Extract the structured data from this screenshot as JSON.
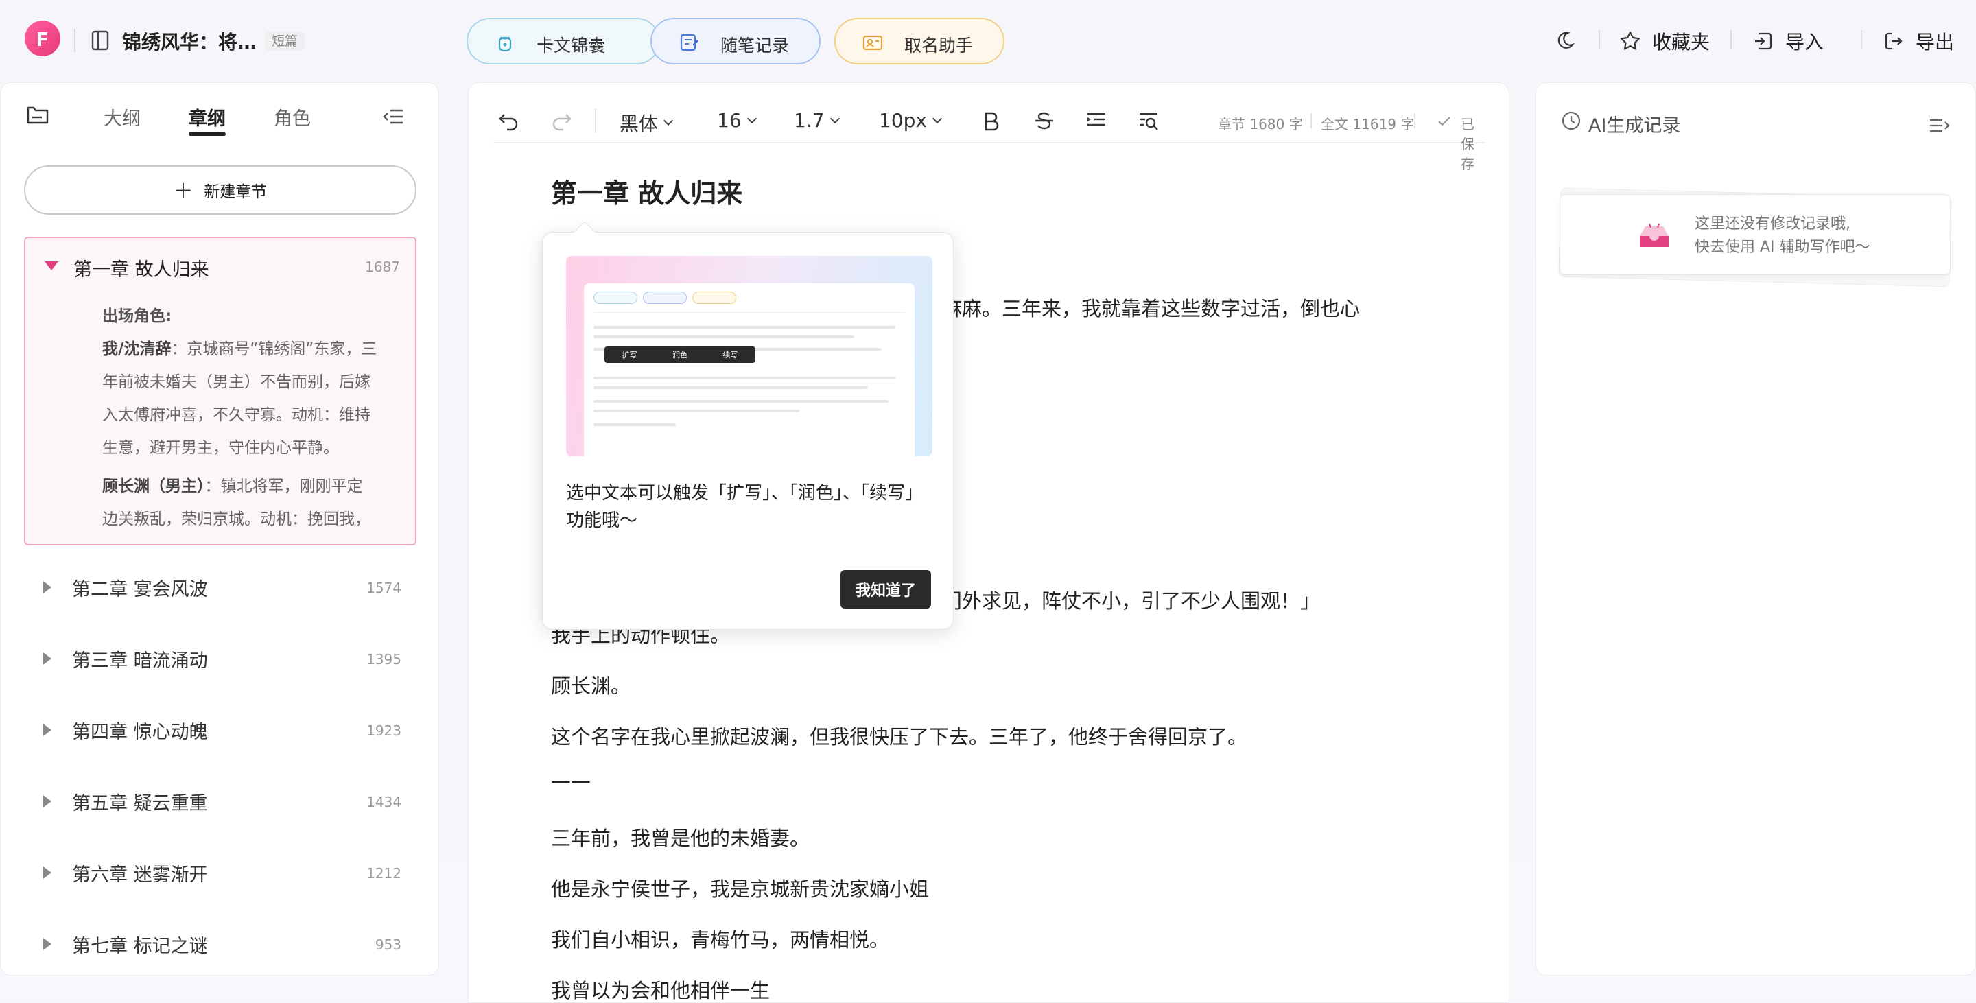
{
  "header": {
    "doc_title": "锦绣风华：将…",
    "doc_tag": "短篇",
    "pills": [
      "卡文锦囊",
      "随笔记录",
      "取名助手"
    ],
    "collect_label": "收藏夹",
    "import_label": "导入",
    "export_label": "导出"
  },
  "sidebar": {
    "tabs": [
      "大纲",
      "章纲",
      "角色"
    ],
    "active_tab": "章纲",
    "new_chapter_label": "新建章节",
    "expanded": {
      "title": "第一章 故人归来",
      "count": "1687",
      "roles_label": "出场角色:",
      "role1_name": "我/沈清辞",
      "role1_desc_l1": "：京城商号“锦绣阁”东家，三",
      "role1_desc_l2": "年前被未婚夫（男主）不告而别，后嫁",
      "role1_desc_l3": "入太傅府冲喜，不久守寡。动机：维持",
      "role1_desc_l4": "生意，避开男主，守住内心平静。",
      "role2_name": "顾长渊（男主）",
      "role2_desc_l1": "：镇北将军，刚刚平定",
      "role2_desc_l2": "边关叛乱，荣归京城。动机：挽回我，"
    },
    "chapters": [
      {
        "title": "第二章 宴会风波",
        "count": "1574"
      },
      {
        "title": "第三章 暗流涌动",
        "count": "1395"
      },
      {
        "title": "第四章 惊心动魄",
        "count": "1923"
      },
      {
        "title": "第五章 疑云重重",
        "count": "1434"
      },
      {
        "title": "第六章 迷雾渐开",
        "count": "1212"
      },
      {
        "title": "第七章 标记之谜",
        "count": "953"
      }
    ]
  },
  "toolbar": {
    "font": "黑体",
    "size": "16",
    "line_height": "1.7",
    "spacing": "10px",
    "chapter_count": "章节 1680 字",
    "total_count": "全文 11619 字",
    "saved": "已保存"
  },
  "editor": {
    "title": "第一章 故人归来",
    "p1_tail": "麻麻。三年来，我就靠着这些数字过活，倒也心",
    "p2_tail": "门外求见，阵仗不小，引了不少人围观！」",
    "p3": "我手上的动作顿住。",
    "p4": "顾长渊。",
    "p5": "这个名字在我心里掀起波澜，但我很快压了下去。三年了，他终于舍得回京了。",
    "p6": "——",
    "p7": "三年前，我曾是他的未婚妻。",
    "p8": "他是永宁侯世子，我是京城新贵沈家嫡小姐",
    "p9": "我们自小相识，青梅竹马，两情相悦。",
    "p10": "我曾以为会和他相伴一生"
  },
  "tooltip": {
    "text": "选中文本可以触发「扩写」、「润色」、「续写」功能哦～",
    "button": "我知道了",
    "preview_actions": [
      "扩写",
      "润色",
      "续写"
    ]
  },
  "right_panel": {
    "title": "AI生成记录",
    "empty_l1": "这里还没有修改记录哦,",
    "empty_l2": "快去使用 AI 辅助写作吧～"
  },
  "colors": {
    "accent": "#e0417f",
    "pill_blue_border": "#a8d7e8",
    "pill_indigo_border": "#a9c3f0",
    "pill_yellow_border": "#f1cf85"
  }
}
